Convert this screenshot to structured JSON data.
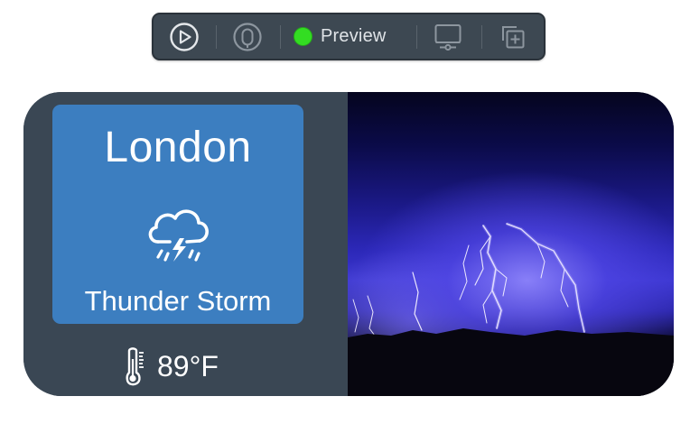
{
  "toolbar": {
    "preview_label": "Preview",
    "preview_status_color": "#33dd22",
    "buttons": [
      {
        "name": "play-icon"
      },
      {
        "name": "live-mode-icon"
      },
      {
        "name": "device-settings-icon"
      },
      {
        "name": "duplicate-icon"
      }
    ]
  },
  "widget": {
    "city": "London",
    "condition": "Thunder Storm",
    "condition_icon": "cloud-thunderstorm-icon",
    "temperature": "89°F",
    "temperature_icon": "thermometer-icon",
    "card_color": "#3c7ec0",
    "panel_color": "#3a4754",
    "photo": "lightning-storm-photo"
  }
}
